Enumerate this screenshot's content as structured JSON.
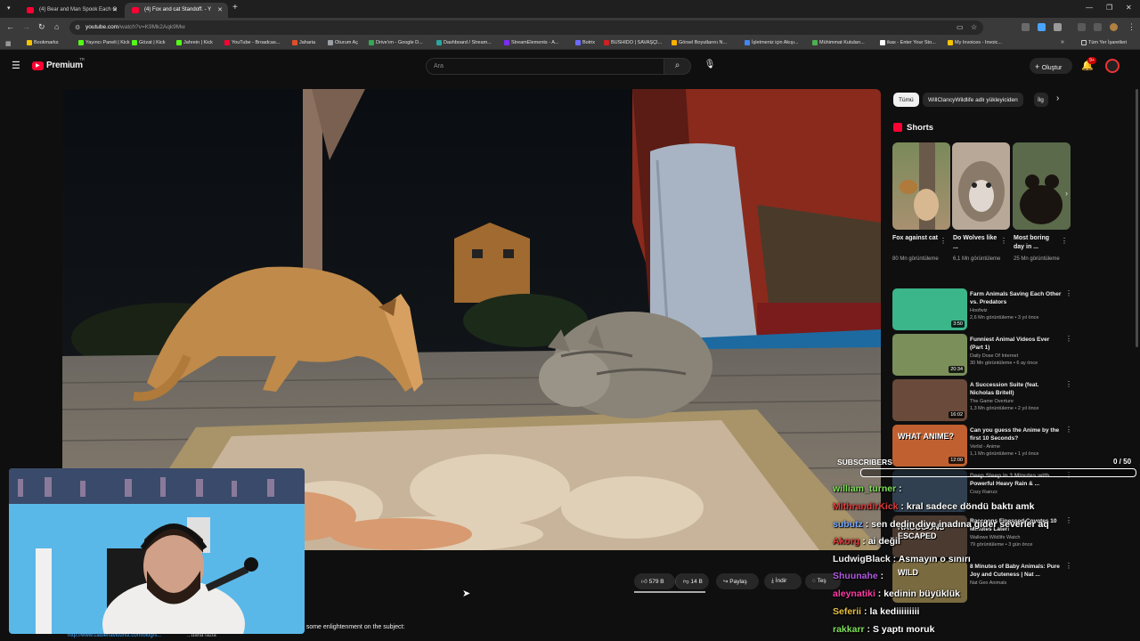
{
  "browser": {
    "tabs": [
      {
        "title": "(4) Bear and Man Spook Each O",
        "active": false
      },
      {
        "title": "(4) Fox and cat Standoff. - Y",
        "active": true
      }
    ],
    "new_tab": "+",
    "url_host": "youtube.com",
    "url_path": "/watch?v=K9Mk2Aqk9Mw",
    "bookmarks": [
      {
        "label": "Bookmarks",
        "color": "#f5c400"
      },
      {
        "label": "Yayıncı Paneli | Kick",
        "color": "#53fc18"
      },
      {
        "label": "Gözat | Kick",
        "color": "#53fc18"
      },
      {
        "label": "Jahrein | Kick",
        "color": "#53fc18"
      },
      {
        "label": "YouTube - Broadcas...",
        "color": "#ff0033"
      },
      {
        "label": "Jaharia",
        "color": "#e04e2a"
      },
      {
        "label": "Oturum Aç",
        "color": "#9aa0a6"
      },
      {
        "label": "Drive'ım - Google D...",
        "color": "#34a853"
      },
      {
        "label": "Dashboard / Stream...",
        "color": "#2aa5a0"
      },
      {
        "label": "StreamElements - A...",
        "color": "#7b2cf5"
      },
      {
        "label": "Botrix",
        "color": "#6b6bff"
      },
      {
        "label": "BUSHIDO | SAVAŞÇI...",
        "color": "#c22"
      },
      {
        "label": "Görsel Boyutlarını N...",
        "color": "#ffb000"
      },
      {
        "label": "İşletmeniz için Akışı...",
        "color": "#4285f4"
      },
      {
        "label": "Mühimmat Kutuları...",
        "color": "#4caf50"
      },
      {
        "label": "ikas - Enter Your Sto...",
        "color": "#ffffff"
      },
      {
        "label": "My Invoices - Invoic...",
        "color": "#f5c400"
      }
    ],
    "all_bookmarks": "Tüm Yer İşaretleri"
  },
  "header": {
    "logo_text": "Premium",
    "logo_sup": "TR",
    "search_placeholder": "Ara",
    "create_label": "Oluştur",
    "notif_count": "9+"
  },
  "chips": [
    {
      "label": "Tümü",
      "active": true
    },
    {
      "label": "WillClancyWildlife adlı yükleyiciden",
      "active": false
    },
    {
      "label": "İlg",
      "active": false
    }
  ],
  "shorts": {
    "heading": "Shorts",
    "items": [
      {
        "title": "Fox against cat",
        "views": "80 Mn görüntüleme"
      },
      {
        "title": "Do Wolves like ...",
        "views": "6,1 Mn görüntüleme"
      },
      {
        "title": "Most boring day in ...",
        "views": "25 Mn görüntüleme"
      }
    ]
  },
  "related": [
    {
      "title": "Farm Animals Saving Each Other vs. Predators",
      "channel": "Hoofwiz",
      "meta": "2,6 Mn görüntüleme • 3 yıl önce",
      "duration": "3:50",
      "color": "#3bb58a"
    },
    {
      "title": "Funniest Animal Videos Ever (Part 1)",
      "channel": "Daily Dose Of Internet",
      "meta": "30 Mn görüntüleme • 6 ay önce",
      "duration": "20:34",
      "color": "#7a8f5a"
    },
    {
      "title": "A Succession Suite (feat. Nicholas Britell)",
      "channel": "The Game Overture",
      "meta": "1,3 Mn görüntüleme • 2 yıl önce",
      "duration": "16:02",
      "color": "#6a4a3a"
    },
    {
      "title": "Can you guess the Anime by the first 10 Seconds?",
      "channel": "Verlid - Anime",
      "meta": "1,1 Mn görüntüleme • 1 yıl önce",
      "duration": "12:00",
      "color": "#c06030",
      "overlay": "WHAT ANIME?"
    },
    {
      "title": "Deep Sleep in 3 Minutes with Powerful Heavy Rain & ...",
      "channel": "Cozy Rainzz",
      "meta": "",
      "duration": "",
      "color": "#304050"
    },
    {
      "title": "Raccoons Finessed Coyotes 10 Minutes Later!",
      "channel": "Wallows Wildlife Watch",
      "meta": "79 görüntüleme • 3 gün önce",
      "duration": "",
      "color": "#4a3a30",
      "overlay": "RACCOONS ESCAPED"
    },
    {
      "title": "8 Minutes of Baby Animals: Pure Joy and Cuteness | Nat ...",
      "channel": "Nat Geo Animals",
      "meta": "",
      "duration": "",
      "color": "#7a6a40",
      "overlay": "WILD"
    }
  ],
  "actions": {
    "like": "579 B",
    "dislike": "14 B",
    "share": "Paylaş",
    "download": "İndir",
    "thanks": "Teş"
  },
  "description": {
    "link": "http://www.catbehaviourist.com/blog/s...",
    "more": "...daha fazla",
    "snippet": "e is some enlightenment on the subject:"
  },
  "stream_overlay": {
    "subs_label": "SUBSCRIBERS",
    "subs_count": "0 / 50",
    "chat": [
      {
        "user": "william_turner",
        "user_color": "#7fe05a",
        "msg": ""
      },
      {
        "user": "MithrandirKick",
        "user_color": "#e03a3a",
        "msg": "kral sadece döndü baktı amk"
      },
      {
        "user": "subutz",
        "user_color": "#7aa8ff",
        "msg": "sen dedin diye inadına gider severler aq"
      },
      {
        "user": "Akorg",
        "user_color": "#e03a3a",
        "msg": "ai değil"
      },
      {
        "user": "LudwigBlack",
        "user_color": "#f1f1f1",
        "msg": "Asmayın o sınırı"
      },
      {
        "user": "Shuunahe",
        "user_color": "#b05ae0",
        "msg": ""
      },
      {
        "user": "aleynatiki",
        "user_color": "#ff3ea5",
        "msg": "kedinin büyüklük"
      },
      {
        "user": "Seferii",
        "user_color": "#e8c040",
        "msg": "la kediiiiiiiii"
      },
      {
        "user": "rakkarr",
        "user_color": "#7fe05a",
        "msg": "S yaptı moruk"
      }
    ]
  }
}
